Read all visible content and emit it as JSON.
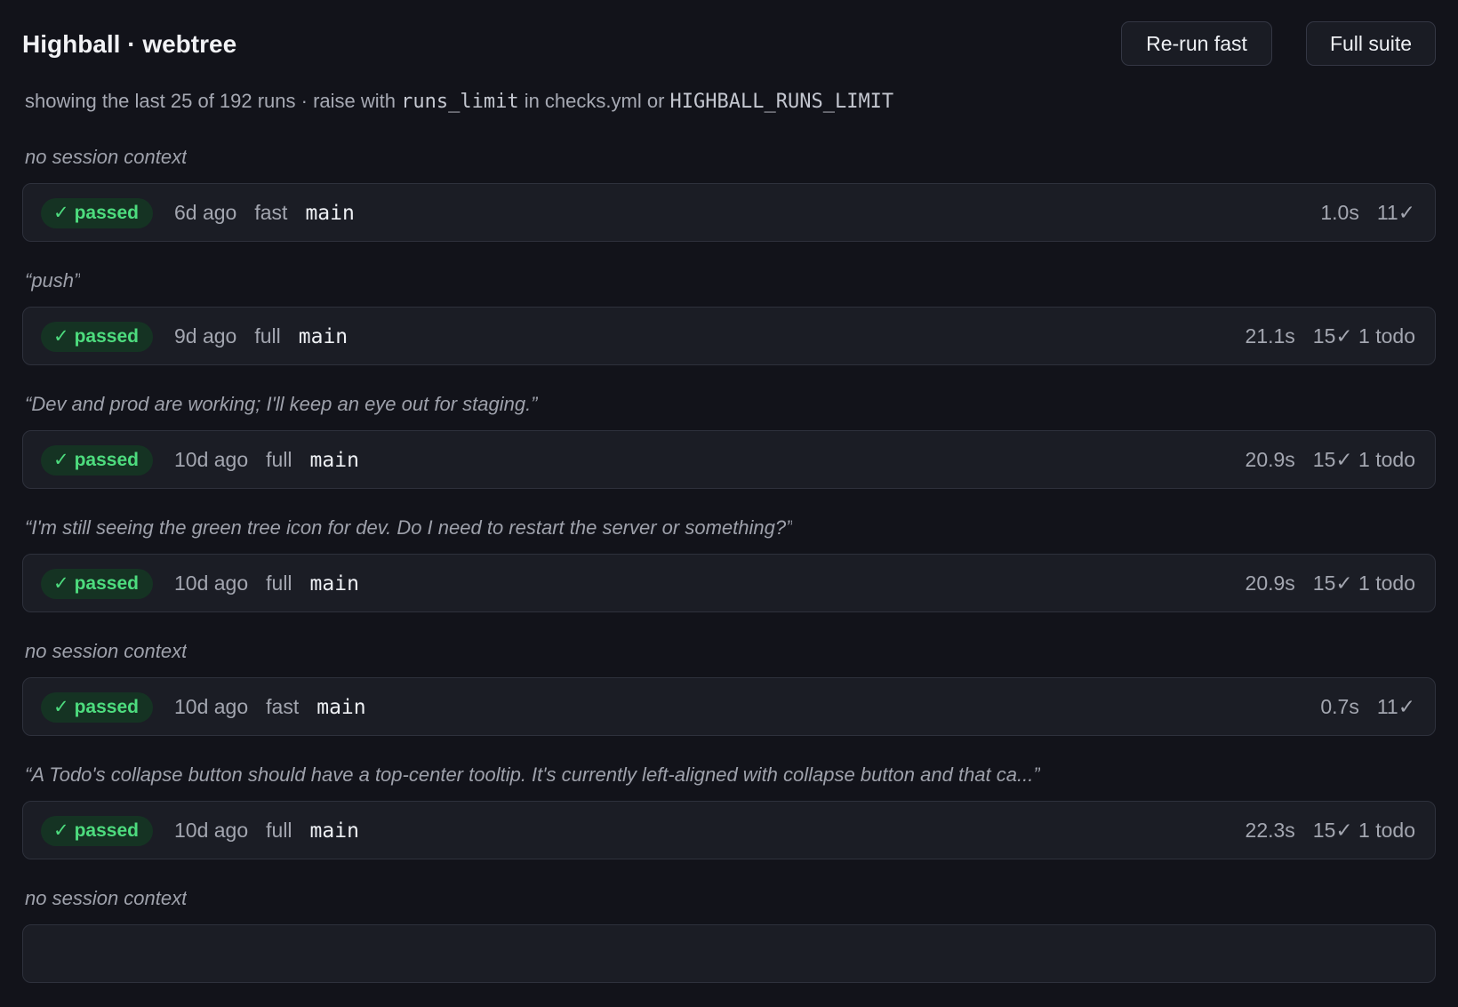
{
  "header": {
    "title": "Highball · webtree",
    "rerun_label": "Re-run fast",
    "full_label": "Full suite"
  },
  "limit_note": {
    "prefix": "showing the last 25 of 192 runs · raise with ",
    "code1": "runs_limit",
    "middle": " in checks.yml or ",
    "code2": "HIGHBALL_RUNS_LIMIT"
  },
  "runs": [
    {
      "context": "no session context",
      "status": "passed",
      "age": "6d ago",
      "kind": "fast",
      "branch": "main",
      "duration": "1.0s",
      "results": "11✓"
    },
    {
      "context": "“push”",
      "status": "passed",
      "age": "9d ago",
      "kind": "full",
      "branch": "main",
      "duration": "21.1s",
      "results": "15✓ 1 todo"
    },
    {
      "context": "“Dev and prod are working; I'll keep an eye out for staging.”",
      "status": "passed",
      "age": "10d ago",
      "kind": "full",
      "branch": "main",
      "duration": "20.9s",
      "results": "15✓ 1 todo"
    },
    {
      "context": "“I'm still seeing the green tree icon for dev. Do I need to restart the server or something?”",
      "status": "passed",
      "age": "10d ago",
      "kind": "full",
      "branch": "main",
      "duration": "20.9s",
      "results": "15✓ 1 todo"
    },
    {
      "context": "no session context",
      "status": "passed",
      "age": "10d ago",
      "kind": "fast",
      "branch": "main",
      "duration": "0.7s",
      "results": "11✓"
    },
    {
      "context": "“A Todo's collapse button should have a top-center tooltip. It's currently left-aligned with collapse button and that ca...”",
      "status": "passed",
      "age": "10d ago",
      "kind": "full",
      "branch": "main",
      "duration": "22.3s",
      "results": "15✓ 1 todo"
    },
    {
      "context": "no session context"
    }
  ],
  "colors": {
    "background": "#12131a",
    "card": "#1b1d25",
    "passed_text": "#4ddc7e",
    "passed_bg": "#153323"
  },
  "icons": {
    "status_check": "check-icon"
  }
}
